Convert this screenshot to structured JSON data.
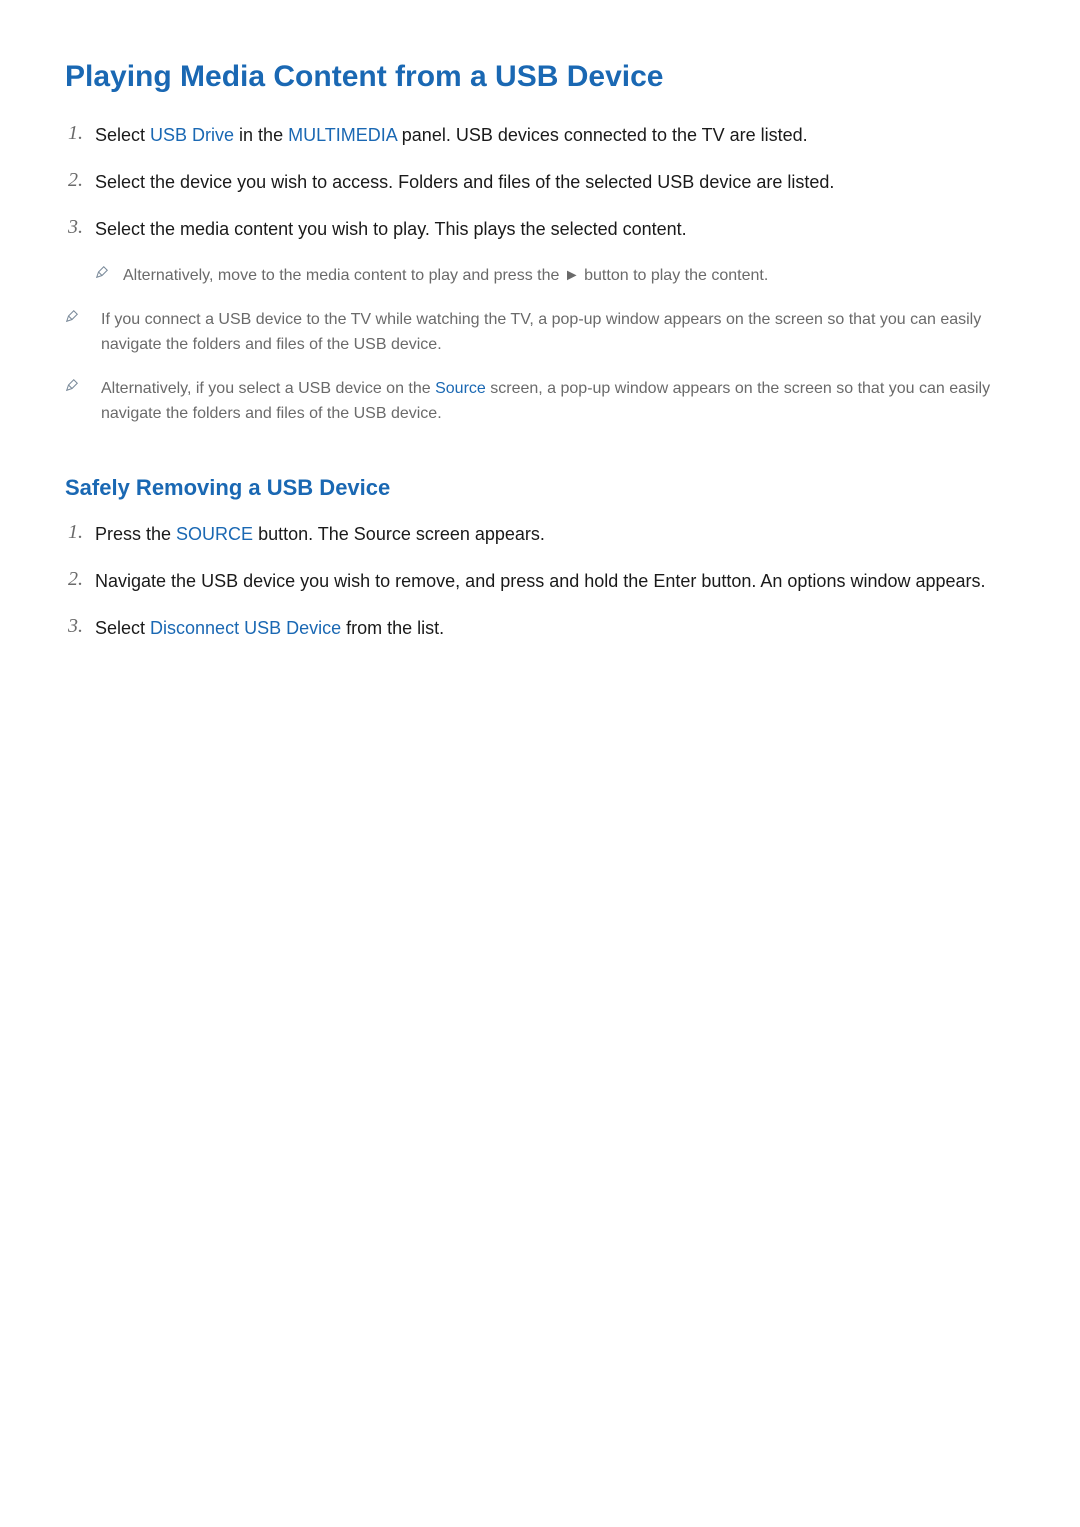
{
  "section1": {
    "title": "Playing Media Content from a USB Device",
    "steps": [
      {
        "num": "1.",
        "prefix": "Select ",
        "link1": "USB Drive",
        "mid1": " in the ",
        "link2": "MULTIMEDIA",
        "suffix": " panel. USB devices connected to the TV are listed."
      },
      {
        "num": "2.",
        "text": "Select the device you wish to access. Folders and files of the selected USB device are listed."
      },
      {
        "num": "3.",
        "text": "Select the media content you wish to play. This plays the selected content."
      }
    ],
    "subnote": {
      "prefix": "Alternatively, move to the media content to play and press the ",
      "symbol": "►",
      "suffix": " button to play the content."
    },
    "notes": [
      {
        "text": "If you connect a USB device to the TV while watching the TV, a pop-up window appears on the screen so that you can easily navigate the folders and files of the USB device."
      },
      {
        "prefix": "Alternatively, if you select a USB device on the ",
        "link": "Source",
        "suffix": " screen, a pop-up window appears on the screen so that you can easily navigate the folders and files of the USB device."
      }
    ]
  },
  "section2": {
    "title": "Safely Removing a USB Device",
    "steps": [
      {
        "num": "1.",
        "prefix": "Press the ",
        "link": "SOURCE",
        "suffix": " button. The Source screen appears."
      },
      {
        "num": "2.",
        "text": "Navigate the USB device you wish to remove, and press and hold the Enter button. An options window appears."
      },
      {
        "num": "3.",
        "prefix": "Select ",
        "link": "Disconnect USB Device",
        "suffix": " from the list."
      }
    ]
  }
}
